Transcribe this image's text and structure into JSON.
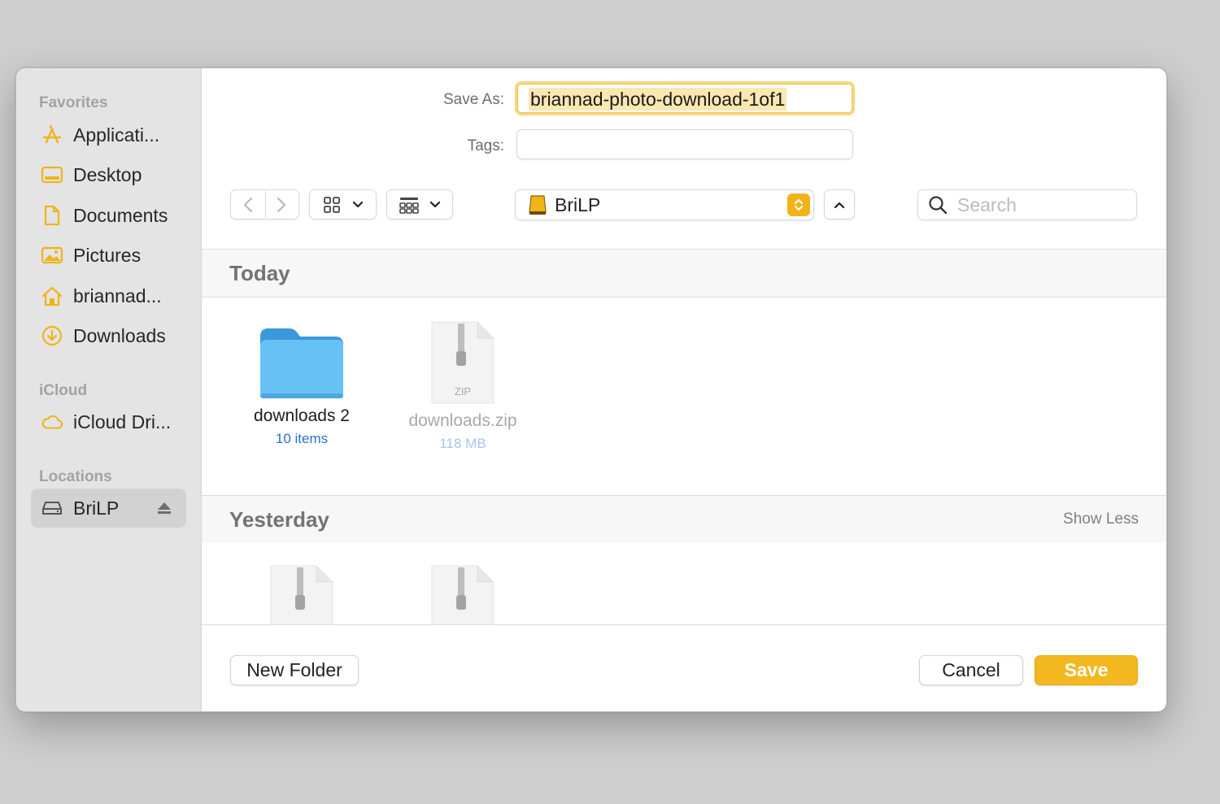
{
  "sidebar": {
    "sections": [
      {
        "title": "Favorites"
      },
      {
        "title": "iCloud"
      },
      {
        "title": "Locations"
      }
    ],
    "favorites": [
      {
        "label": "Applicati...",
        "icon": "applications-icon"
      },
      {
        "label": "Desktop",
        "icon": "desktop-icon"
      },
      {
        "label": "Documents",
        "icon": "documents-icon"
      },
      {
        "label": "Pictures",
        "icon": "pictures-icon"
      },
      {
        "label": "briannad...",
        "icon": "home-icon"
      },
      {
        "label": "Downloads",
        "icon": "downloads-icon"
      }
    ],
    "icloud": [
      {
        "label": "iCloud Dri...",
        "icon": "icloud-icon"
      }
    ],
    "locations": [
      {
        "label": "BriLP",
        "icon": "drive-icon",
        "selected": true
      }
    ]
  },
  "form": {
    "save_as_label": "Save As:",
    "save_as_value": "briannad-photo-download-1of1",
    "tags_label": "Tags:",
    "tags_value": ""
  },
  "toolbar": {
    "location": "BriLP",
    "search_placeholder": "Search"
  },
  "groups": [
    {
      "title": "Today",
      "files": [
        {
          "name": "downloads 2",
          "meta": "10 items",
          "type": "folder",
          "dimmed": false
        },
        {
          "name": "downloads.zip",
          "meta": "118 MB",
          "type": "zip",
          "dimmed": true
        }
      ]
    },
    {
      "title": "Yesterday",
      "action": "Show Less",
      "files": [
        {
          "type": "zip"
        },
        {
          "type": "zip"
        }
      ]
    }
  ],
  "zip_label": "ZIP",
  "buttons": {
    "new_folder": "New Folder",
    "cancel": "Cancel",
    "save": "Save"
  },
  "colors": {
    "accent": "#f3b81f",
    "sidebar_icon": "#f0b419",
    "folder": "#5ab8f2",
    "meta_link": "#2a6fd4"
  }
}
